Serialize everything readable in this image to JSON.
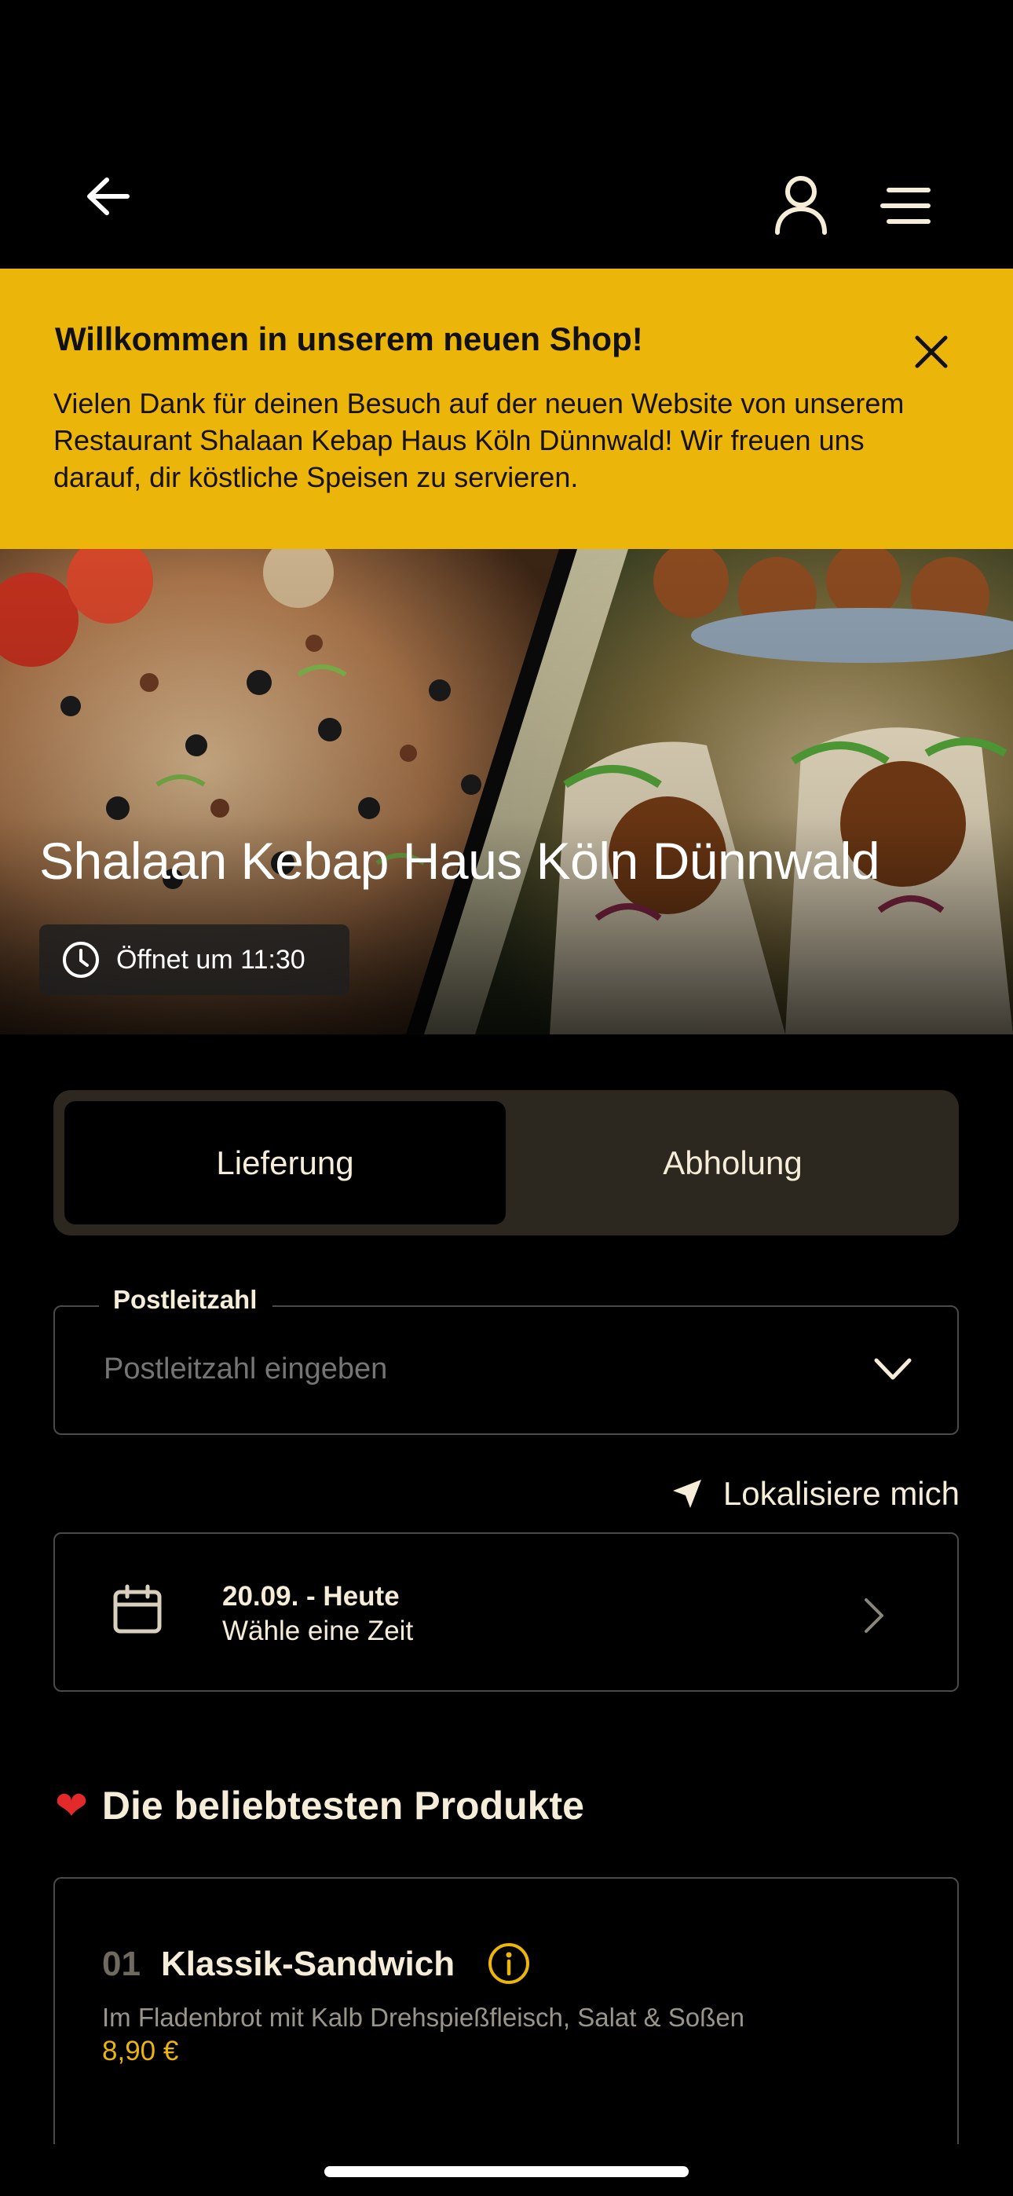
{
  "header": {
    "back_icon": "arrow-left-icon",
    "user_icon": "user-icon",
    "menu_icon": "menu-icon"
  },
  "banner": {
    "title": "Willkommen in unserem neuen Shop!",
    "text": "Vielen Dank für deinen Besuch auf der neuen Website von unserem Restaurant Shalaan Kebap Haus Köln Dünnwald! Wir freuen uns darauf, dir köstliche Speisen zu servieren.",
    "close_icon": "close-icon",
    "color": "#ebb50a"
  },
  "hero": {
    "restaurant_name": "Shalaan Kebap Haus Köln Dünnwald",
    "opening_status": "Öffnet um 11:30"
  },
  "mode_toggle": {
    "options": [
      "Lieferung",
      "Abholung"
    ],
    "selected": "Lieferung"
  },
  "postcode": {
    "label": "Postleitzahl",
    "placeholder": "Postleitzahl eingeben",
    "value": ""
  },
  "locate": {
    "label": "Lokalisiere mich"
  },
  "time_selector": {
    "date": "20.09. - Heute",
    "subtitle": "Wähle eine Zeit"
  },
  "popular": {
    "title": "Die beliebtesten Produkte",
    "items": [
      {
        "number": "01",
        "name": "Klassik-Sandwich",
        "description": "Im Fladenbrot mit Kalb Drehspießfleisch, Salat & Soßen",
        "price": "8,90 €"
      }
    ]
  },
  "colors": {
    "accent": "#ebb50a",
    "background": "#000000",
    "text": "#f6edd9"
  }
}
